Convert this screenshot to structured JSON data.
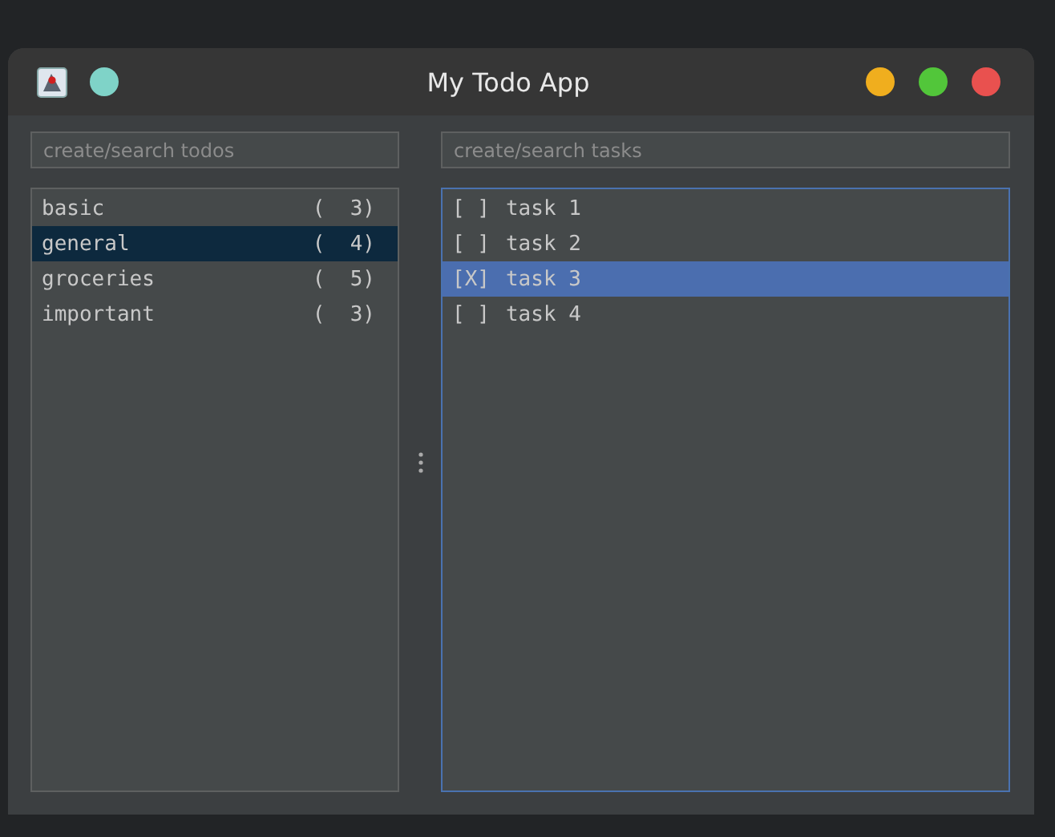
{
  "window": {
    "title": "My Todo App",
    "pin_button": {
      "color": "#7fd3c8"
    },
    "controls": [
      {
        "color": "#f0ae1e"
      },
      {
        "color": "#52c63a"
      },
      {
        "color": "#e9514f"
      }
    ]
  },
  "todo_panel": {
    "search": {
      "placeholder": "create/search todos"
    },
    "items": [
      {
        "name": "basic",
        "count": "(  3)",
        "selected": false
      },
      {
        "name": "general",
        "count": "(  4)",
        "selected": true
      },
      {
        "name": "groceries",
        "count": "(  5)",
        "selected": false
      },
      {
        "name": "important",
        "count": "(  3)",
        "selected": false
      }
    ]
  },
  "task_panel": {
    "search": {
      "placeholder": "create/search tasks"
    },
    "items": [
      {
        "box": "[ ]",
        "name": "task 1",
        "selected": false
      },
      {
        "box": "[ ]",
        "name": "task 2",
        "selected": false
      },
      {
        "box": "[X]",
        "name": "task 3",
        "selected": true
      },
      {
        "box": "[ ]",
        "name": "task 4",
        "selected": false
      }
    ]
  }
}
